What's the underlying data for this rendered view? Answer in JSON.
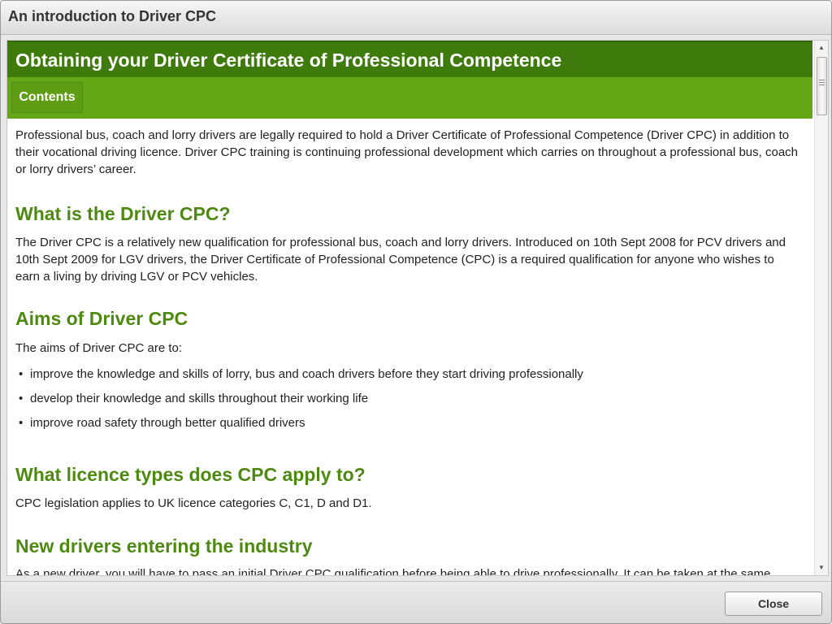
{
  "window": {
    "title": "An introduction to Driver CPC"
  },
  "page": {
    "heading": "Obtaining your Driver Certificate of Professional Competence",
    "contents_label": "Contents",
    "intro": "Professional bus, coach and lorry drivers are legally required to hold a Driver Certificate of Professional Competence (Driver CPC) in addition to their vocational driving licence. Driver CPC training is continuing professional development which carries on throughout a professional bus, coach or lorry drivers’ career.",
    "sections": [
      {
        "heading": "What is the Driver CPC?",
        "text": "The Driver CPC is a relatively new qualification for professional bus, coach and lorry drivers. Introduced on 10th Sept 2008 for PCV drivers and 10th Sept 2009 for LGV drivers, the Driver Certificate of Professional Competence (CPC) is a required qualification for anyone who wishes to earn a living by driving LGV or PCV vehicles."
      },
      {
        "heading": "Aims of Driver CPC",
        "text": "The aims of Driver CPC are to:",
        "bullets": [
          "improve the knowledge and skills of lorry, bus and coach drivers before they start driving professionally",
          "develop their knowledge and skills throughout their working life",
          "improve road safety through better qualified drivers"
        ]
      },
      {
        "heading": "What licence types does CPC apply to?",
        "text": "CPC legislation applies to UK licence categories C, C1, D and D1."
      },
      {
        "heading": "New drivers entering the industry",
        "text": "As a new driver, you will have to pass an initial Driver CPC qualification before being able to drive professionally. It can be taken at the same"
      }
    ]
  },
  "scrollbar": {
    "position": 0.0
  },
  "footer": {
    "close_label": "Close"
  },
  "colors": {
    "header_dark_green": "#3e7a0c",
    "header_light_green": "#65a617",
    "section_heading_green": "#4e8a12"
  }
}
